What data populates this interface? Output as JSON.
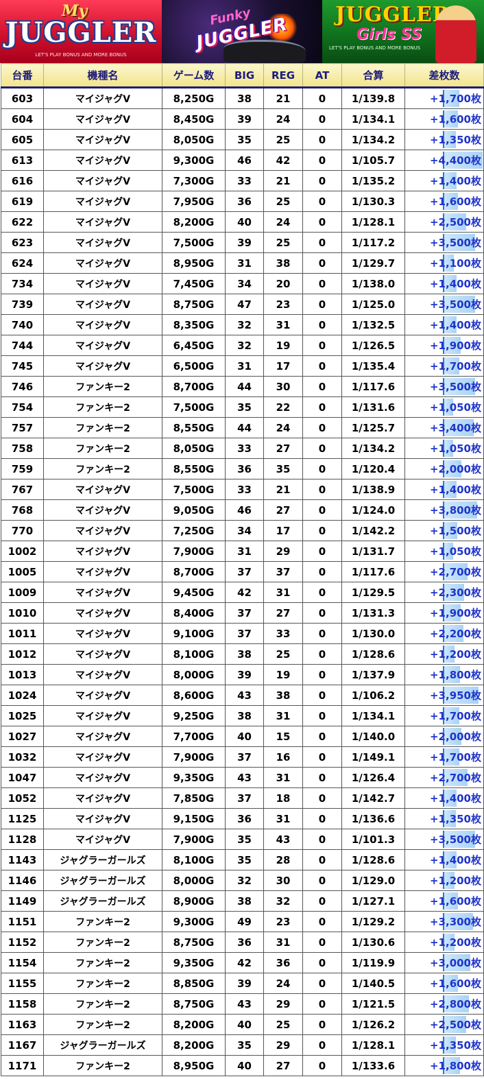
{
  "banners": {
    "my_juggler": {
      "my": "My",
      "title": "JUGGLER",
      "sub": "LET'S PLAY BONUS AND MORE BONUS"
    },
    "funky": {
      "funky": "Funky",
      "title": "JUGGLER",
      "number": "2"
    },
    "girls": {
      "title": "JUGGLER",
      "sub_title": "Girls SS",
      "sub": "LET'S PLAY BONUS AND MORE BONUS"
    }
  },
  "columns": [
    "台番",
    "機種名",
    "ゲーム数",
    "BIG",
    "REG",
    "AT",
    "合算",
    "差枚数"
  ],
  "accent_colors": {
    "header_text": "#1c1c7a",
    "diff_text": "#1f34c9",
    "bar": "#a9d3f6"
  },
  "rows": [
    {
      "no": "603",
      "name": "マイジャグV",
      "games": "8,250G",
      "big": "38",
      "reg": "21",
      "at": "0",
      "total": "1/139.8",
      "diff": "+1,700枚",
      "diff_value": 1700
    },
    {
      "no": "604",
      "name": "マイジャグV",
      "games": "8,450G",
      "big": "39",
      "reg": "24",
      "at": "0",
      "total": "1/134.1",
      "diff": "+1,600枚",
      "diff_value": 1600
    },
    {
      "no": "605",
      "name": "マイジャグV",
      "games": "8,050G",
      "big": "35",
      "reg": "25",
      "at": "0",
      "total": "1/134.2",
      "diff": "+1,350枚",
      "diff_value": 1350
    },
    {
      "no": "613",
      "name": "マイジャグV",
      "games": "9,300G",
      "big": "46",
      "reg": "42",
      "at": "0",
      "total": "1/105.7",
      "diff": "+4,400枚",
      "diff_value": 4400
    },
    {
      "no": "616",
      "name": "マイジャグV",
      "games": "7,300G",
      "big": "33",
      "reg": "21",
      "at": "0",
      "total": "1/135.2",
      "diff": "+1,400枚",
      "diff_value": 1400
    },
    {
      "no": "619",
      "name": "マイジャグV",
      "games": "7,950G",
      "big": "36",
      "reg": "25",
      "at": "0",
      "total": "1/130.3",
      "diff": "+1,600枚",
      "diff_value": 1600
    },
    {
      "no": "622",
      "name": "マイジャグV",
      "games": "8,200G",
      "big": "40",
      "reg": "24",
      "at": "0",
      "total": "1/128.1",
      "diff": "+2,500枚",
      "diff_value": 2500
    },
    {
      "no": "623",
      "name": "マイジャグV",
      "games": "7,500G",
      "big": "39",
      "reg": "25",
      "at": "0",
      "total": "1/117.2",
      "diff": "+3,500枚",
      "diff_value": 3500
    },
    {
      "no": "624",
      "name": "マイジャグV",
      "games": "8,950G",
      "big": "31",
      "reg": "38",
      "at": "0",
      "total": "1/129.7",
      "diff": "+1,100枚",
      "diff_value": 1100
    },
    {
      "no": "734",
      "name": "マイジャグV",
      "games": "7,450G",
      "big": "34",
      "reg": "20",
      "at": "0",
      "total": "1/138.0",
      "diff": "+1,400枚",
      "diff_value": 1400
    },
    {
      "no": "739",
      "name": "マイジャグV",
      "games": "8,750G",
      "big": "47",
      "reg": "23",
      "at": "0",
      "total": "1/125.0",
      "diff": "+3,500枚",
      "diff_value": 3500
    },
    {
      "no": "740",
      "name": "マイジャグV",
      "games": "8,350G",
      "big": "32",
      "reg": "31",
      "at": "0",
      "total": "1/132.5",
      "diff": "+1,400枚",
      "diff_value": 1400
    },
    {
      "no": "744",
      "name": "マイジャグV",
      "games": "6,450G",
      "big": "32",
      "reg": "19",
      "at": "0",
      "total": "1/126.5",
      "diff": "+1,900枚",
      "diff_value": 1900
    },
    {
      "no": "745",
      "name": "マイジャグV",
      "games": "6,500G",
      "big": "31",
      "reg": "17",
      "at": "0",
      "total": "1/135.4",
      "diff": "+1,700枚",
      "diff_value": 1700
    },
    {
      "no": "746",
      "name": "ファンキー2",
      "games": "8,700G",
      "big": "44",
      "reg": "30",
      "at": "0",
      "total": "1/117.6",
      "diff": "+3,500枚",
      "diff_value": 3500
    },
    {
      "no": "754",
      "name": "ファンキー2",
      "games": "7,500G",
      "big": "35",
      "reg": "22",
      "at": "0",
      "total": "1/131.6",
      "diff": "+1,050枚",
      "diff_value": 1050
    },
    {
      "no": "757",
      "name": "ファンキー2",
      "games": "8,550G",
      "big": "44",
      "reg": "24",
      "at": "0",
      "total": "1/125.7",
      "diff": "+3,400枚",
      "diff_value": 3400
    },
    {
      "no": "758",
      "name": "ファンキー2",
      "games": "8,050G",
      "big": "33",
      "reg": "27",
      "at": "0",
      "total": "1/134.2",
      "diff": "+1,050枚",
      "diff_value": 1050
    },
    {
      "no": "759",
      "name": "ファンキー2",
      "games": "8,550G",
      "big": "36",
      "reg": "35",
      "at": "0",
      "total": "1/120.4",
      "diff": "+2,000枚",
      "diff_value": 2000
    },
    {
      "no": "767",
      "name": "マイジャグV",
      "games": "7,500G",
      "big": "33",
      "reg": "21",
      "at": "0",
      "total": "1/138.9",
      "diff": "+1,400枚",
      "diff_value": 1400
    },
    {
      "no": "768",
      "name": "マイジャグV",
      "games": "9,050G",
      "big": "46",
      "reg": "27",
      "at": "0",
      "total": "1/124.0",
      "diff": "+3,800枚",
      "diff_value": 3800
    },
    {
      "no": "770",
      "name": "マイジャグV",
      "games": "7,250G",
      "big": "34",
      "reg": "17",
      "at": "0",
      "total": "1/142.2",
      "diff": "+1,500枚",
      "diff_value": 1500
    },
    {
      "no": "1002",
      "name": "マイジャグV",
      "games": "7,900G",
      "big": "31",
      "reg": "29",
      "at": "0",
      "total": "1/131.7",
      "diff": "+1,050枚",
      "diff_value": 1050
    },
    {
      "no": "1005",
      "name": "マイジャグV",
      "games": "8,700G",
      "big": "37",
      "reg": "37",
      "at": "0",
      "total": "1/117.6",
      "diff": "+2,700枚",
      "diff_value": 2700
    },
    {
      "no": "1009",
      "name": "マイジャグV",
      "games": "9,450G",
      "big": "42",
      "reg": "31",
      "at": "0",
      "total": "1/129.5",
      "diff": "+2,300枚",
      "diff_value": 2300
    },
    {
      "no": "1010",
      "name": "マイジャグV",
      "games": "8,400G",
      "big": "37",
      "reg": "27",
      "at": "0",
      "total": "1/131.3",
      "diff": "+1,900枚",
      "diff_value": 1900
    },
    {
      "no": "1011",
      "name": "マイジャグV",
      "games": "9,100G",
      "big": "37",
      "reg": "33",
      "at": "0",
      "total": "1/130.0",
      "diff": "+2,200枚",
      "diff_value": 2200
    },
    {
      "no": "1012",
      "name": "マイジャグV",
      "games": "8,100G",
      "big": "38",
      "reg": "25",
      "at": "0",
      "total": "1/128.6",
      "diff": "+1,200枚",
      "diff_value": 1200
    },
    {
      "no": "1013",
      "name": "マイジャグV",
      "games": "8,000G",
      "big": "39",
      "reg": "19",
      "at": "0",
      "total": "1/137.9",
      "diff": "+1,800枚",
      "diff_value": 1800
    },
    {
      "no": "1024",
      "name": "マイジャグV",
      "games": "8,600G",
      "big": "43",
      "reg": "38",
      "at": "0",
      "total": "1/106.2",
      "diff": "+3,950枚",
      "diff_value": 3950
    },
    {
      "no": "1025",
      "name": "マイジャグV",
      "games": "9,250G",
      "big": "38",
      "reg": "31",
      "at": "0",
      "total": "1/134.1",
      "diff": "+1,700枚",
      "diff_value": 1700
    },
    {
      "no": "1027",
      "name": "マイジャグV",
      "games": "7,700G",
      "big": "40",
      "reg": "15",
      "at": "0",
      "total": "1/140.0",
      "diff": "+2,000枚",
      "diff_value": 2000
    },
    {
      "no": "1032",
      "name": "マイジャグV",
      "games": "7,900G",
      "big": "37",
      "reg": "16",
      "at": "0",
      "total": "1/149.1",
      "diff": "+1,700枚",
      "diff_value": 1700
    },
    {
      "no": "1047",
      "name": "マイジャグV",
      "games": "9,350G",
      "big": "43",
      "reg": "31",
      "at": "0",
      "total": "1/126.4",
      "diff": "+2,700枚",
      "diff_value": 2700
    },
    {
      "no": "1052",
      "name": "マイジャグV",
      "games": "7,850G",
      "big": "37",
      "reg": "18",
      "at": "0",
      "total": "1/142.7",
      "diff": "+1,400枚",
      "diff_value": 1400
    },
    {
      "no": "1125",
      "name": "マイジャグV",
      "games": "9,150G",
      "big": "36",
      "reg": "31",
      "at": "0",
      "total": "1/136.6",
      "diff": "+1,350枚",
      "diff_value": 1350
    },
    {
      "no": "1128",
      "name": "マイジャグV",
      "games": "7,900G",
      "big": "35",
      "reg": "43",
      "at": "0",
      "total": "1/101.3",
      "diff": "+3,500枚",
      "diff_value": 3500
    },
    {
      "no": "1143",
      "name": "ジャグラーガールズ",
      "games": "8,100G",
      "big": "35",
      "reg": "28",
      "at": "0",
      "total": "1/128.6",
      "diff": "+1,400枚",
      "diff_value": 1400
    },
    {
      "no": "1146",
      "name": "ジャグラーガールズ",
      "games": "8,000G",
      "big": "32",
      "reg": "30",
      "at": "0",
      "total": "1/129.0",
      "diff": "+1,200枚",
      "diff_value": 1200
    },
    {
      "no": "1149",
      "name": "ジャグラーガールズ",
      "games": "8,900G",
      "big": "38",
      "reg": "32",
      "at": "0",
      "total": "1/127.1",
      "diff": "+1,600枚",
      "diff_value": 1600
    },
    {
      "no": "1151",
      "name": "ファンキー2",
      "games": "9,300G",
      "big": "49",
      "reg": "23",
      "at": "0",
      "total": "1/129.2",
      "diff": "+3,300枚",
      "diff_value": 3300
    },
    {
      "no": "1152",
      "name": "ファンキー2",
      "games": "8,750G",
      "big": "36",
      "reg": "31",
      "at": "0",
      "total": "1/130.6",
      "diff": "+1,200枚",
      "diff_value": 1200
    },
    {
      "no": "1154",
      "name": "ファンキー2",
      "games": "9,350G",
      "big": "42",
      "reg": "36",
      "at": "0",
      "total": "1/119.9",
      "diff": "+3,000枚",
      "diff_value": 3000
    },
    {
      "no": "1155",
      "name": "ファンキー2",
      "games": "8,850G",
      "big": "39",
      "reg": "24",
      "at": "0",
      "total": "1/140.5",
      "diff": "+1,600枚",
      "diff_value": 1600
    },
    {
      "no": "1158",
      "name": "ファンキー2",
      "games": "8,750G",
      "big": "43",
      "reg": "29",
      "at": "0",
      "total": "1/121.5",
      "diff": "+2,800枚",
      "diff_value": 2800
    },
    {
      "no": "1163",
      "name": "ファンキー2",
      "games": "8,200G",
      "big": "40",
      "reg": "25",
      "at": "0",
      "total": "1/126.2",
      "diff": "+2,500枚",
      "diff_value": 2500
    },
    {
      "no": "1167",
      "name": "ジャグラーガールズ",
      "games": "8,200G",
      "big": "35",
      "reg": "29",
      "at": "0",
      "total": "1/128.1",
      "diff": "+1,350枚",
      "diff_value": 1350
    },
    {
      "no": "1171",
      "name": "ファンキー2",
      "games": "8,950G",
      "big": "40",
      "reg": "27",
      "at": "0",
      "total": "1/133.6",
      "diff": "+1,800枚",
      "diff_value": 1800
    }
  ]
}
